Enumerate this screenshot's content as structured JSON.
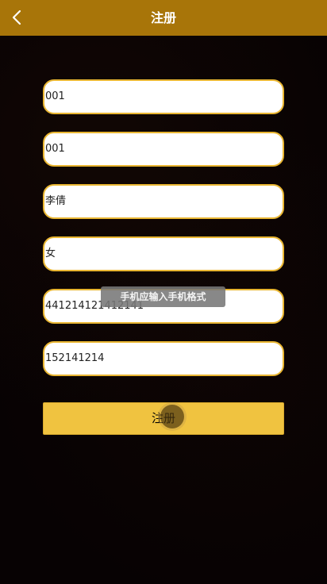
{
  "header": {
    "title": "注册",
    "back_icon": "chevron-left-icon",
    "background_color": "#a87509"
  },
  "form": {
    "fields": [
      {
        "value": "001"
      },
      {
        "value": "001"
      },
      {
        "value": "李倩"
      },
      {
        "value": "女"
      },
      {
        "value": "441214121412141"
      },
      {
        "value": "152141214"
      }
    ],
    "submit_label": "注册",
    "accent_color": "#f0c340",
    "border_color": "#e9b632"
  },
  "toast": {
    "message": "手机应输入手机格式"
  }
}
